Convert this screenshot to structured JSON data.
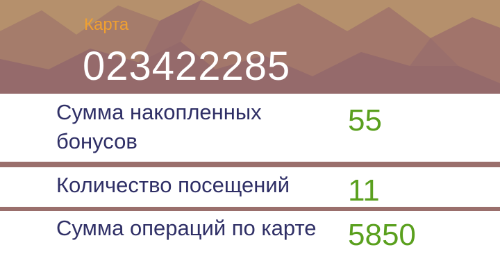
{
  "card": {
    "label": "Карта",
    "number": "023422285"
  },
  "stats": [
    {
      "label": "Сумма накопленных бонусов",
      "value": "55"
    },
    {
      "label": "Количество посещений",
      "value": "11"
    },
    {
      "label": "Сумма операций по карте",
      "value": "5850"
    }
  ],
  "colors": {
    "label_accent": "#f0a030",
    "value": "#5aa01e",
    "text": "#2f2f66",
    "header_background": "#9a6f6c"
  }
}
